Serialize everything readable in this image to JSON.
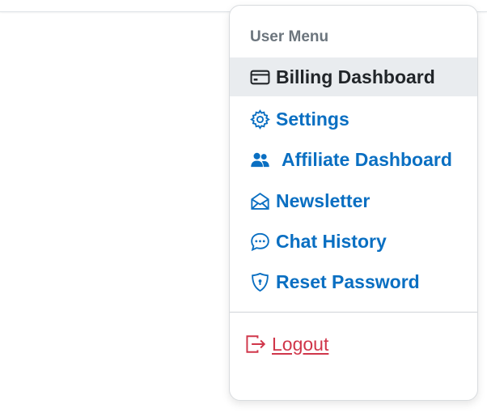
{
  "menu": {
    "header": "User Menu",
    "items": [
      {
        "label": "Billing Dashboard",
        "icon": "credit-card-icon",
        "active": true
      },
      {
        "label": "Settings",
        "icon": "gear-icon",
        "active": false
      },
      {
        "label": "Affiliate Dashboard",
        "icon": "people-icon",
        "active": false
      },
      {
        "label": "Newsletter",
        "icon": "envelope-open-icon",
        "active": false
      },
      {
        "label": "Chat History",
        "icon": "chat-dots-icon",
        "active": false
      },
      {
        "label": "Reset Password",
        "icon": "shield-lock-icon",
        "active": false
      }
    ],
    "logout": {
      "label": "Logout",
      "icon": "box-arrow-right-icon"
    }
  },
  "colors": {
    "link": "#0a6fc2",
    "active_bg": "#e9ecef",
    "active_text": "#212529",
    "header_text": "#6c757d",
    "danger": "#d0364a"
  }
}
